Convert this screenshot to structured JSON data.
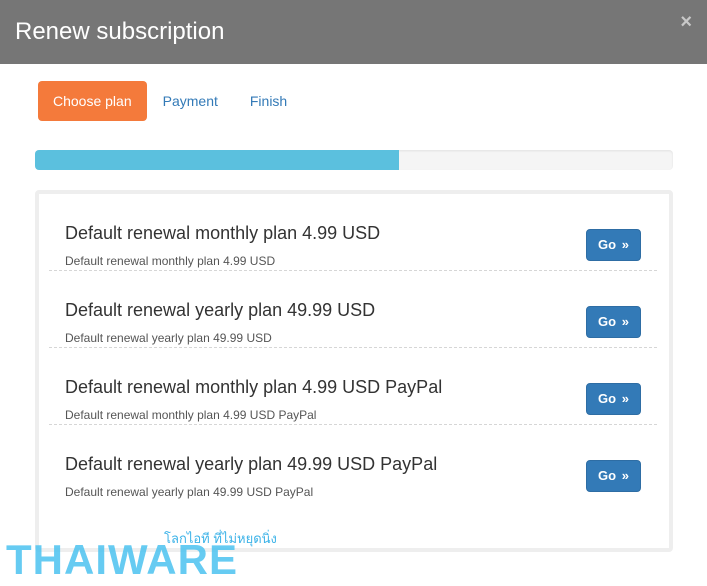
{
  "modal": {
    "title": "Renew subscription",
    "close_icon": "×"
  },
  "tabs": [
    {
      "label": "Choose plan",
      "active": true
    },
    {
      "label": "Payment",
      "active": false
    },
    {
      "label": "Finish",
      "active": false
    }
  ],
  "progress": {
    "value_fraction": 0.57
  },
  "plans": [
    {
      "title": "Default renewal monthly plan 4.99 USD",
      "subtitle": "Default renewal monthly plan 4.99 USD",
      "button": "Go"
    },
    {
      "title": "Default renewal yearly plan 49.99 USD",
      "subtitle": "Default renewal yearly plan 49.99 USD",
      "button": "Go"
    },
    {
      "title": "Default renewal monthly plan 4.99 USD PayPal",
      "subtitle": "Default renewal monthly plan 4.99 USD PayPal",
      "button": "Go"
    },
    {
      "title": "Default renewal yearly plan 49.99 USD PayPal",
      "subtitle": "Default renewal yearly plan 49.99 USD PayPal",
      "button": "Go"
    }
  ],
  "watermark": {
    "tagline": "โลกไอที ที่ไม่หยุดนิ่ง",
    "brand": "THAIWARE"
  },
  "colors": {
    "header_bg": "#767676",
    "active_tab": "#f47a3b",
    "progress": "#5bc0de",
    "button": "#337ab7"
  }
}
